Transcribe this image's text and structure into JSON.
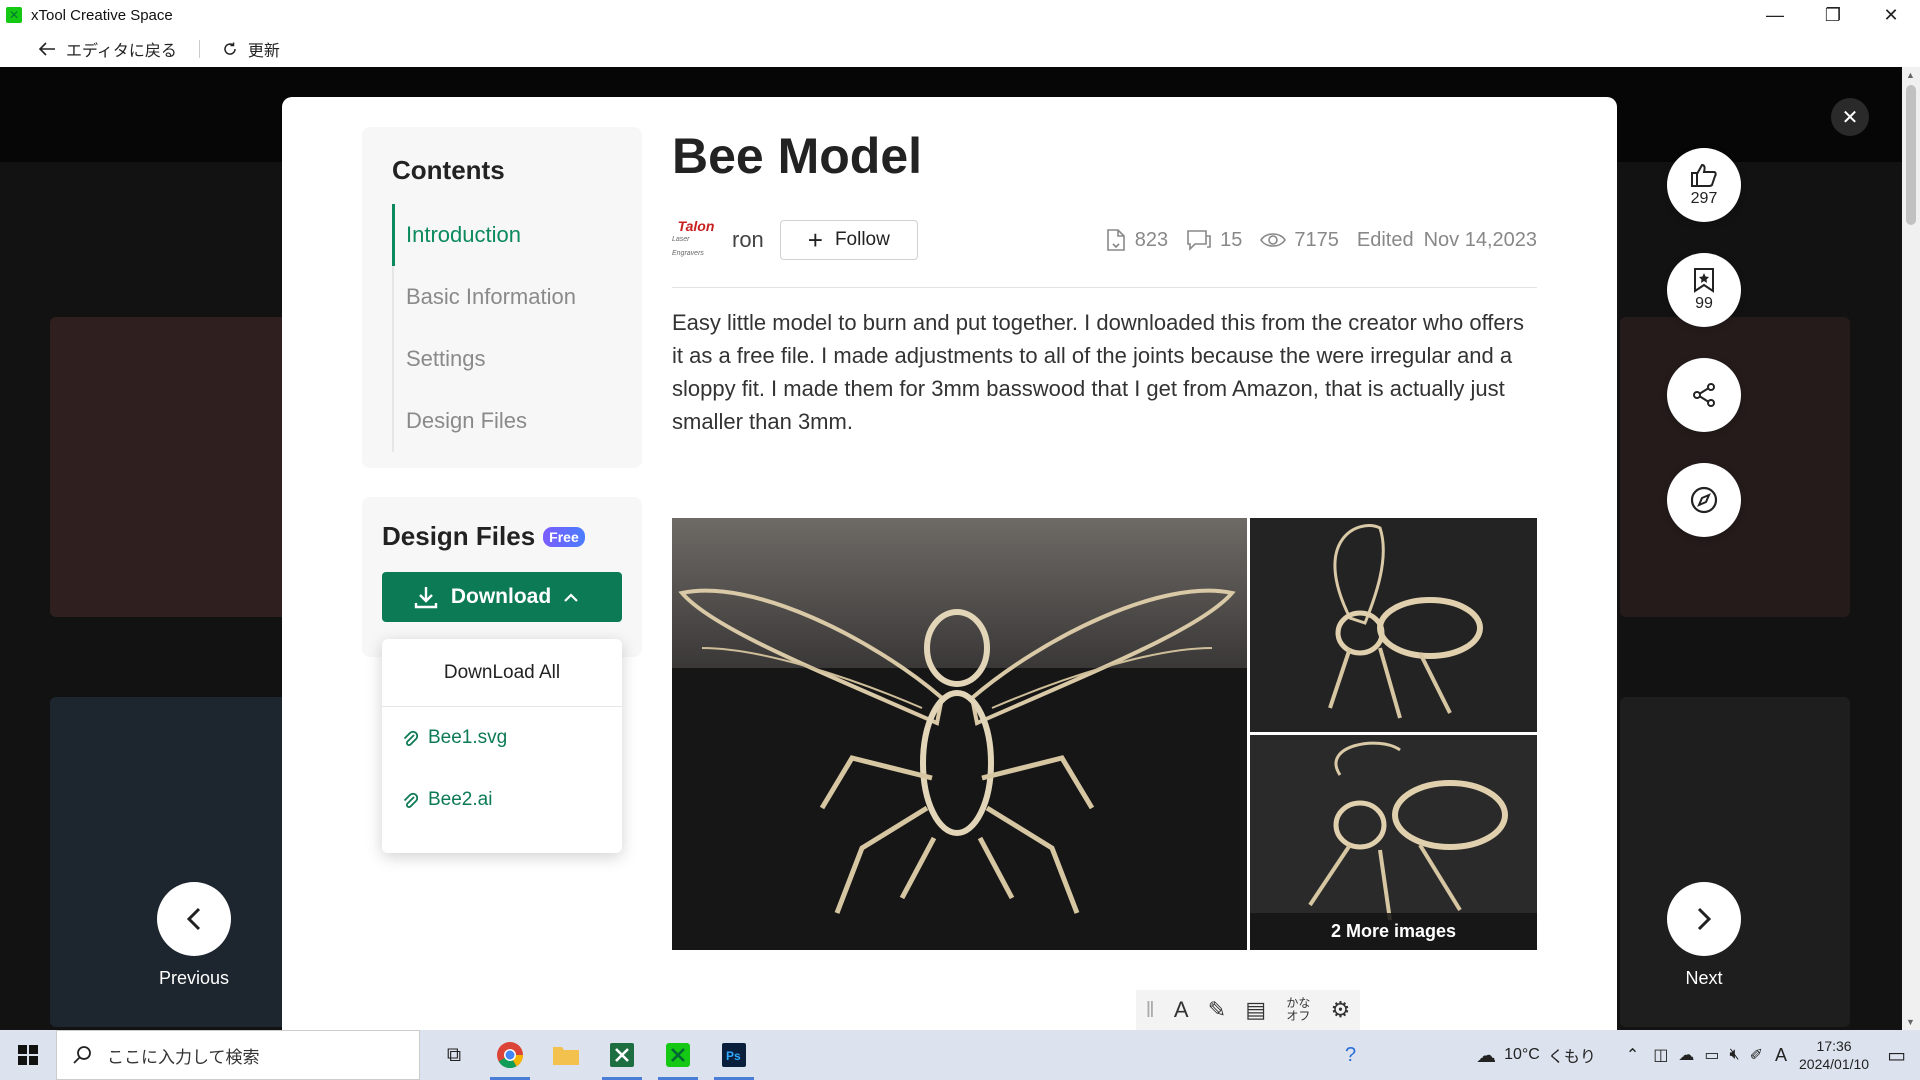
{
  "window": {
    "title": "xTool Creative Space",
    "app_icon": "x-icon"
  },
  "nav": {
    "back_label": "エディタに戻る",
    "refresh_label": "更新"
  },
  "toc": {
    "title": "Contents",
    "items": [
      {
        "label": "Introduction",
        "active": true
      },
      {
        "label": "Basic Information",
        "active": false
      },
      {
        "label": "Settings",
        "active": false
      },
      {
        "label": "Design Files",
        "active": false
      }
    ]
  },
  "design_files": {
    "title": "Design Files",
    "badge": "Free",
    "download_label": "Download",
    "download_all_label": "DownLoad All",
    "files": [
      "Bee1.svg",
      "Bee2.ai"
    ]
  },
  "project": {
    "title": "Bee Model",
    "author": "ron",
    "author_avatar_text": "Talon",
    "avatar_subtext": "Laser Engravers",
    "follow_label": "Follow",
    "downloads": "823",
    "comments": "15",
    "views": "7175",
    "edited_label": "Edited",
    "edited_date": "Nov 14,2023",
    "description": "Easy little model to burn and put together. I downloaded this from the creator who offers it as a free file. I made adjustments to all of the joints because the were irregular and a sloppy fit. I made them for 3mm basswood that I get from Amazon, that is actually just smaller than 3mm.",
    "more_images_label": "2 More images"
  },
  "actions": {
    "likes": "297",
    "bookmarks": "99"
  },
  "pager": {
    "previous_label": "Previous",
    "next_label": "Next"
  },
  "ime": {
    "kana_label": "かな オフ"
  },
  "taskbar": {
    "search_placeholder": "ここに入力して検索",
    "weather_temp": "10°C",
    "weather_text": "くもり",
    "ime_mode": "A",
    "time": "17:36",
    "date": "2024/01/10"
  },
  "colors": {
    "accent": "#0c7a55",
    "active_toc": "#0c8a5e"
  }
}
